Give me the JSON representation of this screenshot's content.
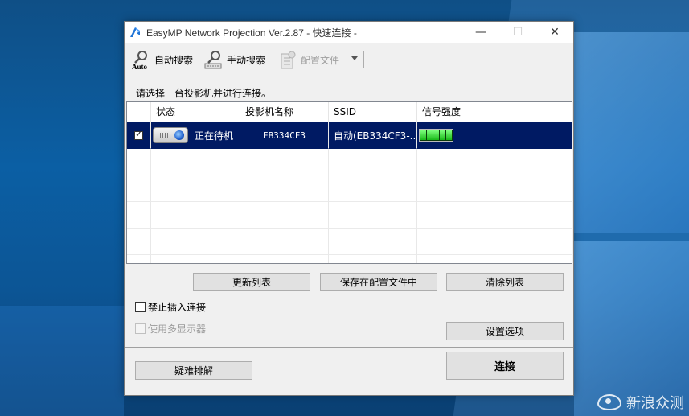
{
  "window": {
    "title": "EasyMP Network Projection Ver.2.87 - 快速连接 -",
    "controls": {
      "minimize": "—",
      "maximize": "☐",
      "close": "✕"
    }
  },
  "toolbar": {
    "auto_search": {
      "label": "自动搜索",
      "icon": "auto-search-icon"
    },
    "manual_search": {
      "label": "手动搜索",
      "icon": "manual-search-icon"
    },
    "profile": {
      "label": "配置文件",
      "icon": "profile-icon",
      "enabled": false
    },
    "path_value": ""
  },
  "hint": "请选择一台投影机并进行连接。",
  "list": {
    "columns": [
      "状态",
      "投影机名称",
      "SSID",
      "信号强度"
    ],
    "rows": [
      {
        "checked": true,
        "check_glyph": "✓",
        "status": "正在待机",
        "name": "EB334CF3",
        "ssid": "自动(EB334CF3-...",
        "signal_bars": 5,
        "selected": true
      }
    ]
  },
  "buttons": {
    "refresh": "更新列表",
    "save_profile": "保存在配置文件中",
    "clear": "清除列表",
    "settings": "设置选项",
    "troubleshoot": "疑难排解",
    "connect": "连接"
  },
  "options": {
    "disable_interrupt": {
      "label": "禁止插入连接",
      "checked": false
    },
    "multi_display": {
      "label": "使用多显示器",
      "checked": false,
      "enabled": false
    }
  },
  "watermark": "新浪众测",
  "colors": {
    "selection": "#001a63",
    "window_bg": "#f0f0f0",
    "signal": "#2fd02f"
  }
}
